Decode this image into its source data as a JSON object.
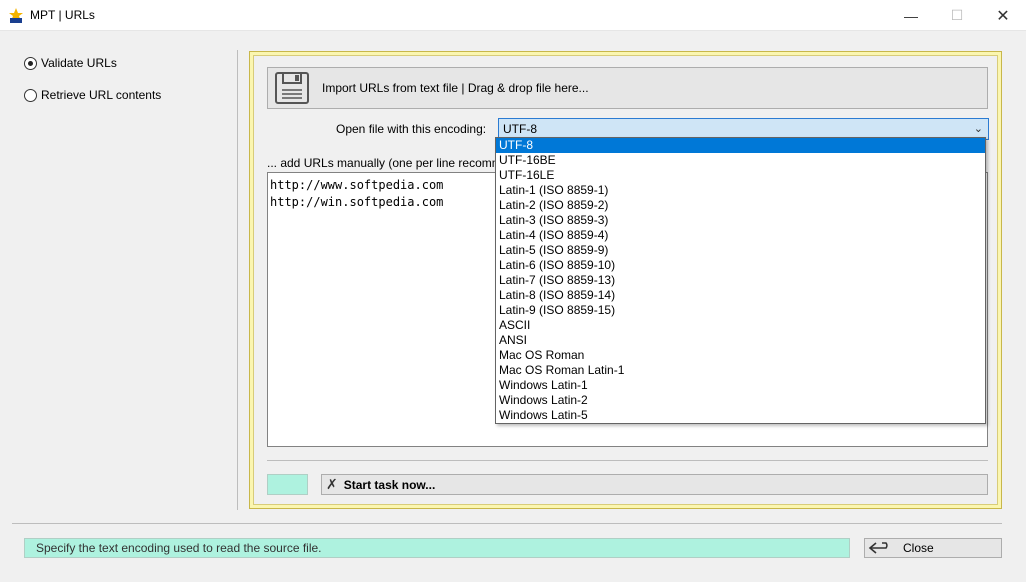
{
  "window": {
    "title": "MPT | URLs",
    "minimize_glyph": "—",
    "maximize_glyph": "☐",
    "close_glyph": "✕"
  },
  "mode": {
    "options": [
      {
        "label": "Validate URLs",
        "checked": true
      },
      {
        "label": "Retrieve URL contents",
        "checked": false
      }
    ]
  },
  "import": {
    "label": "Import URLs from text file | Drag & drop file here...",
    "icon": "floppy-disk-icon"
  },
  "encoding": {
    "label": "Open file with this encoding:",
    "selected": "UTF-8",
    "options": [
      "UTF-8",
      "UTF-16BE",
      "UTF-16LE",
      "Latin-1 (ISO 8859-1)",
      "Latin-2 (ISO 8859-2)",
      "Latin-3 (ISO 8859-3)",
      "Latin-4 (ISO 8859-4)",
      "Latin-5 (ISO 8859-9)",
      "Latin-6 (ISO 8859-10)",
      "Latin-7 (ISO 8859-13)",
      "Latin-8 (ISO 8859-14)",
      "Latin-9 (ISO 8859-15)",
      "ASCII",
      "ANSI",
      "Mac OS Roman",
      "Mac OS Roman Latin-1",
      "Windows Latin-1",
      "Windows Latin-2",
      "Windows Latin-5"
    ]
  },
  "manual": {
    "label": "... add URLs manually (one per line recomm",
    "urls": "http://www.softpedia.com\nhttp://win.softpedia.com"
  },
  "task": {
    "start_label": "Start task now...",
    "swatch_color": "#aef2df"
  },
  "status": {
    "text": "Specify the text encoding used to read the source file."
  },
  "footer": {
    "close_label": "Close"
  },
  "colors": {
    "accent": "#0078d7",
    "frame": "#fbf6b0",
    "status_bg": "#aef2df"
  }
}
